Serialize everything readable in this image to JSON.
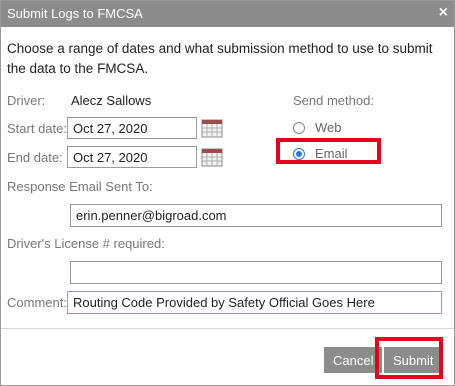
{
  "dialog": {
    "title": "Submit Logs to FMCSA",
    "close_glyph": "×",
    "intro": "Choose a range of dates and what submission method to use to submit the data to the FMCSA."
  },
  "driver": {
    "label": "Driver:",
    "value": "Alecz Sallows"
  },
  "start_date": {
    "label": "Start date:",
    "value": "Oct 27, 2020"
  },
  "end_date": {
    "label": "End date:",
    "value": "Oct 27, 2020"
  },
  "send_method": {
    "label": "Send method:",
    "options": [
      {
        "label": "Web",
        "checked": false
      },
      {
        "label": "Email",
        "checked": true
      }
    ]
  },
  "response_email": {
    "label": "Response Email Sent To:",
    "value": "erin.penner@bigroad.com"
  },
  "license": {
    "label": "Driver's License # required:",
    "value": ""
  },
  "comment": {
    "label": "Comment:",
    "value": "Routing Code Provided by Safety Official Goes Here"
  },
  "buttons": {
    "cancel": "Cancel",
    "submit": "Submit"
  },
  "colors": {
    "titlebar": "#8c8c8c",
    "highlight": "#e8001c",
    "radio_selected": "#2b78e4",
    "button": "#8c8c8c"
  },
  "icons": {
    "calendar": "calendar-icon",
    "close": "close-icon"
  }
}
